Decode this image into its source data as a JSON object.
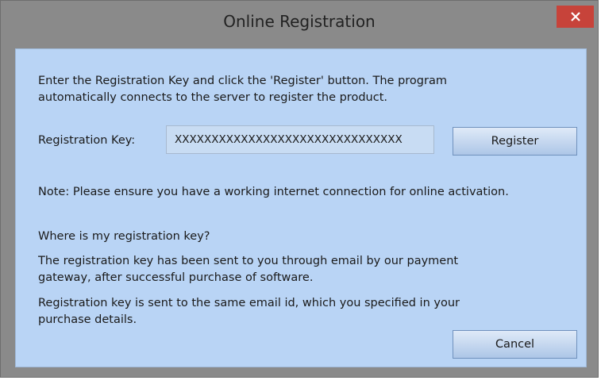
{
  "window": {
    "title": "Online Registration",
    "close_label": "✕"
  },
  "instructions": {
    "line1": "Enter the Registration Key and click the 'Register' button. The program",
    "line2": "automatically connects to the server to register the product."
  },
  "registration": {
    "label": "Registration Key:",
    "key_value": "XXXXXXXXXXXXXXXXXXXXXXXXXXXXXXX",
    "register_label": "Register"
  },
  "note": "Note: Please ensure you have a working internet connection for online activation.",
  "help": {
    "heading": "Where is my registration key?",
    "para1_line1": "The registration key has been sent to you through email by our payment",
    "para1_line2": "gateway, after successful purchase of software.",
    "para2_line1": "Registration key is sent to the same email id, which you specified in your",
    "para2_line2": "purchase details."
  },
  "footer": {
    "cancel_label": "Cancel"
  },
  "colors": {
    "close_button": "#c7433a",
    "client_background": "#b9d4f5",
    "frame": "#8a8a8a"
  }
}
